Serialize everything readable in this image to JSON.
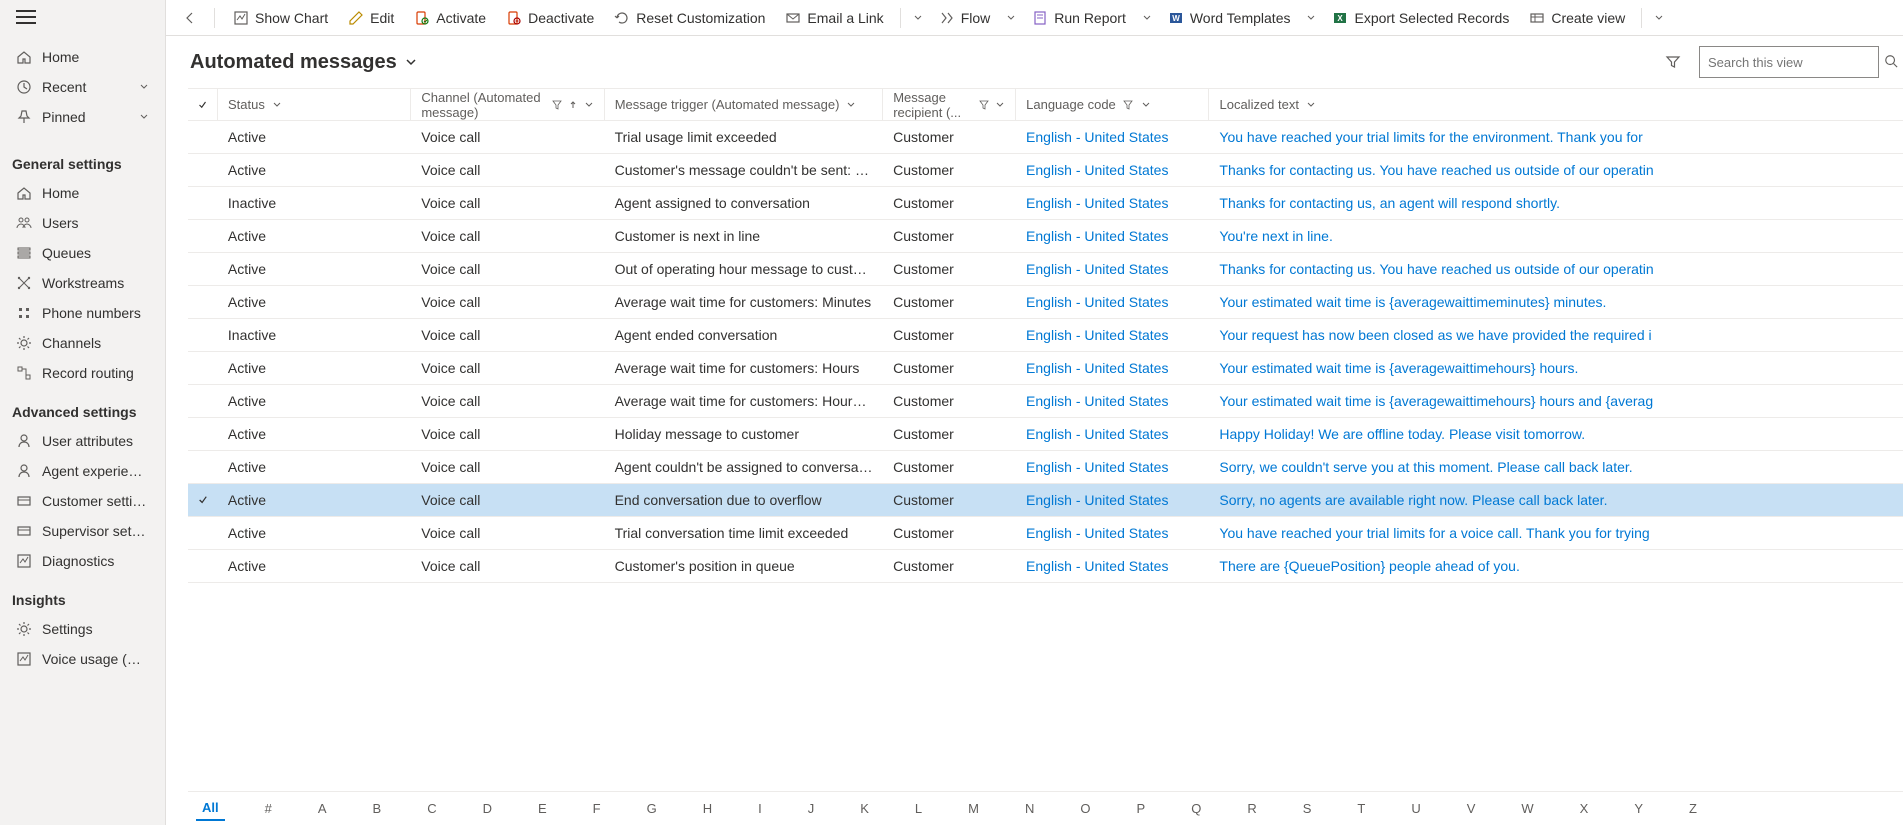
{
  "sidebar": {
    "top": [
      {
        "icon": "home",
        "label": "Home"
      },
      {
        "icon": "recent",
        "label": "Recent",
        "chev": true
      },
      {
        "icon": "pin",
        "label": "Pinned",
        "chev": true
      }
    ],
    "sections": [
      {
        "title": "General settings",
        "items": [
          {
            "icon": "home",
            "label": "Home"
          },
          {
            "icon": "users",
            "label": "Users"
          },
          {
            "icon": "queues",
            "label": "Queues"
          },
          {
            "icon": "work",
            "label": "Workstreams"
          },
          {
            "icon": "phone",
            "label": "Phone numbers"
          },
          {
            "icon": "gear",
            "label": "Channels"
          },
          {
            "icon": "route",
            "label": "Record routing"
          }
        ]
      },
      {
        "title": "Advanced settings",
        "items": [
          {
            "icon": "user",
            "label": "User attributes"
          },
          {
            "icon": "agent",
            "label": "Agent experience"
          },
          {
            "icon": "cust",
            "label": "Customer settings"
          },
          {
            "icon": "sup",
            "label": "Supervisor settings"
          },
          {
            "icon": "diag",
            "label": "Diagnostics"
          }
        ]
      },
      {
        "title": "Insights",
        "items": [
          {
            "icon": "gear",
            "label": "Settings"
          },
          {
            "icon": "chart",
            "label": "Voice usage (Preview)"
          }
        ]
      }
    ]
  },
  "commands": [
    {
      "icon": "chart",
      "label": "Show Chart"
    },
    {
      "icon": "edit",
      "label": "Edit"
    },
    {
      "icon": "activate",
      "label": "Activate"
    },
    {
      "icon": "deactivate",
      "label": "Deactivate"
    },
    {
      "icon": "reset",
      "label": "Reset Customization"
    },
    {
      "icon": "email",
      "label": "Email a Link",
      "split": true
    },
    {
      "icon": "flow",
      "label": "Flow",
      "drop": true
    },
    {
      "icon": "report",
      "label": "Run Report",
      "drop": true
    },
    {
      "icon": "word",
      "label": "Word Templates",
      "drop": true
    },
    {
      "icon": "excel",
      "label": "Export Selected Records"
    },
    {
      "icon": "view",
      "label": "Create view",
      "split": true
    }
  ],
  "header": {
    "title": "Automated messages",
    "searchPlaceholder": "Search this view"
  },
  "columns": {
    "status": "Status",
    "channel": "Channel (Automated message)",
    "trigger": "Message trigger (Automated message)",
    "recipient": "Message recipient (...",
    "lang": "Language code",
    "text": "Localized text"
  },
  "rows": [
    {
      "status": "Active",
      "channel": "Voice call",
      "trigger": "Trial usage limit exceeded",
      "recipient": "Customer",
      "lang": "English - United States",
      "text": "You have reached your trial limits for the environment. Thank you for"
    },
    {
      "status": "Active",
      "channel": "Voice call",
      "trigger": "Customer's message couldn't be sent: Outside ...",
      "recipient": "Customer",
      "lang": "English - United States",
      "text": "Thanks for contacting us. You have reached us outside of our operatin"
    },
    {
      "status": "Inactive",
      "channel": "Voice call",
      "trigger": "Agent assigned to conversation",
      "recipient": "Customer",
      "lang": "English - United States",
      "text": "Thanks for contacting us, an agent will respond shortly."
    },
    {
      "status": "Active",
      "channel": "Voice call",
      "trigger": "Customer is next in line",
      "recipient": "Customer",
      "lang": "English - United States",
      "text": "You're next in line."
    },
    {
      "status": "Active",
      "channel": "Voice call",
      "trigger": "Out of operating hour message to customer",
      "recipient": "Customer",
      "lang": "English - United States",
      "text": "Thanks for contacting us. You have reached us outside of our operatin"
    },
    {
      "status": "Active",
      "channel": "Voice call",
      "trigger": "Average wait time for customers: Minutes",
      "recipient": "Customer",
      "lang": "English - United States",
      "text": "Your estimated wait time is {averagewaittimeminutes} minutes."
    },
    {
      "status": "Inactive",
      "channel": "Voice call",
      "trigger": "Agent ended conversation",
      "recipient": "Customer",
      "lang": "English - United States",
      "text": "Your request has now been closed as we have provided the required i"
    },
    {
      "status": "Active",
      "channel": "Voice call",
      "trigger": "Average wait time for customers: Hours",
      "recipient": "Customer",
      "lang": "English - United States",
      "text": "Your estimated wait time is {averagewaittimehours} hours."
    },
    {
      "status": "Active",
      "channel": "Voice call",
      "trigger": "Average wait time for customers: Hours and mi...",
      "recipient": "Customer",
      "lang": "English - United States",
      "text": "Your estimated wait time is {averagewaittimehours} hours and {averag"
    },
    {
      "status": "Active",
      "channel": "Voice call",
      "trigger": "Holiday message to customer",
      "recipient": "Customer",
      "lang": "English - United States",
      "text": "Happy Holiday! We are offline today. Please visit tomorrow."
    },
    {
      "status": "Active",
      "channel": "Voice call",
      "trigger": "Agent couldn't be assigned to conversation",
      "recipient": "Customer",
      "lang": "English - United States",
      "text": "Sorry, we couldn't serve you at this moment. Please call back later."
    },
    {
      "status": "Active",
      "channel": "Voice call",
      "trigger": "End conversation due to overflow",
      "recipient": "Customer",
      "lang": "English - United States",
      "text": "Sorry, no agents are available right now. Please call back later.",
      "selected": true
    },
    {
      "status": "Active",
      "channel": "Voice call",
      "trigger": "Trial conversation time limit exceeded",
      "recipient": "Customer",
      "lang": "English - United States",
      "text": "You have reached your trial limits for a voice call. Thank you for trying"
    },
    {
      "status": "Active",
      "channel": "Voice call",
      "trigger": "Customer's position in queue",
      "recipient": "Customer",
      "lang": "English - United States",
      "text": "There are {QueuePosition} people ahead of you."
    }
  ],
  "jumpbar": [
    "All",
    "#",
    "A",
    "B",
    "C",
    "D",
    "E",
    "F",
    "G",
    "H",
    "I",
    "J",
    "K",
    "L",
    "M",
    "N",
    "O",
    "P",
    "Q",
    "R",
    "S",
    "T",
    "U",
    "V",
    "W",
    "X",
    "Y",
    "Z"
  ]
}
